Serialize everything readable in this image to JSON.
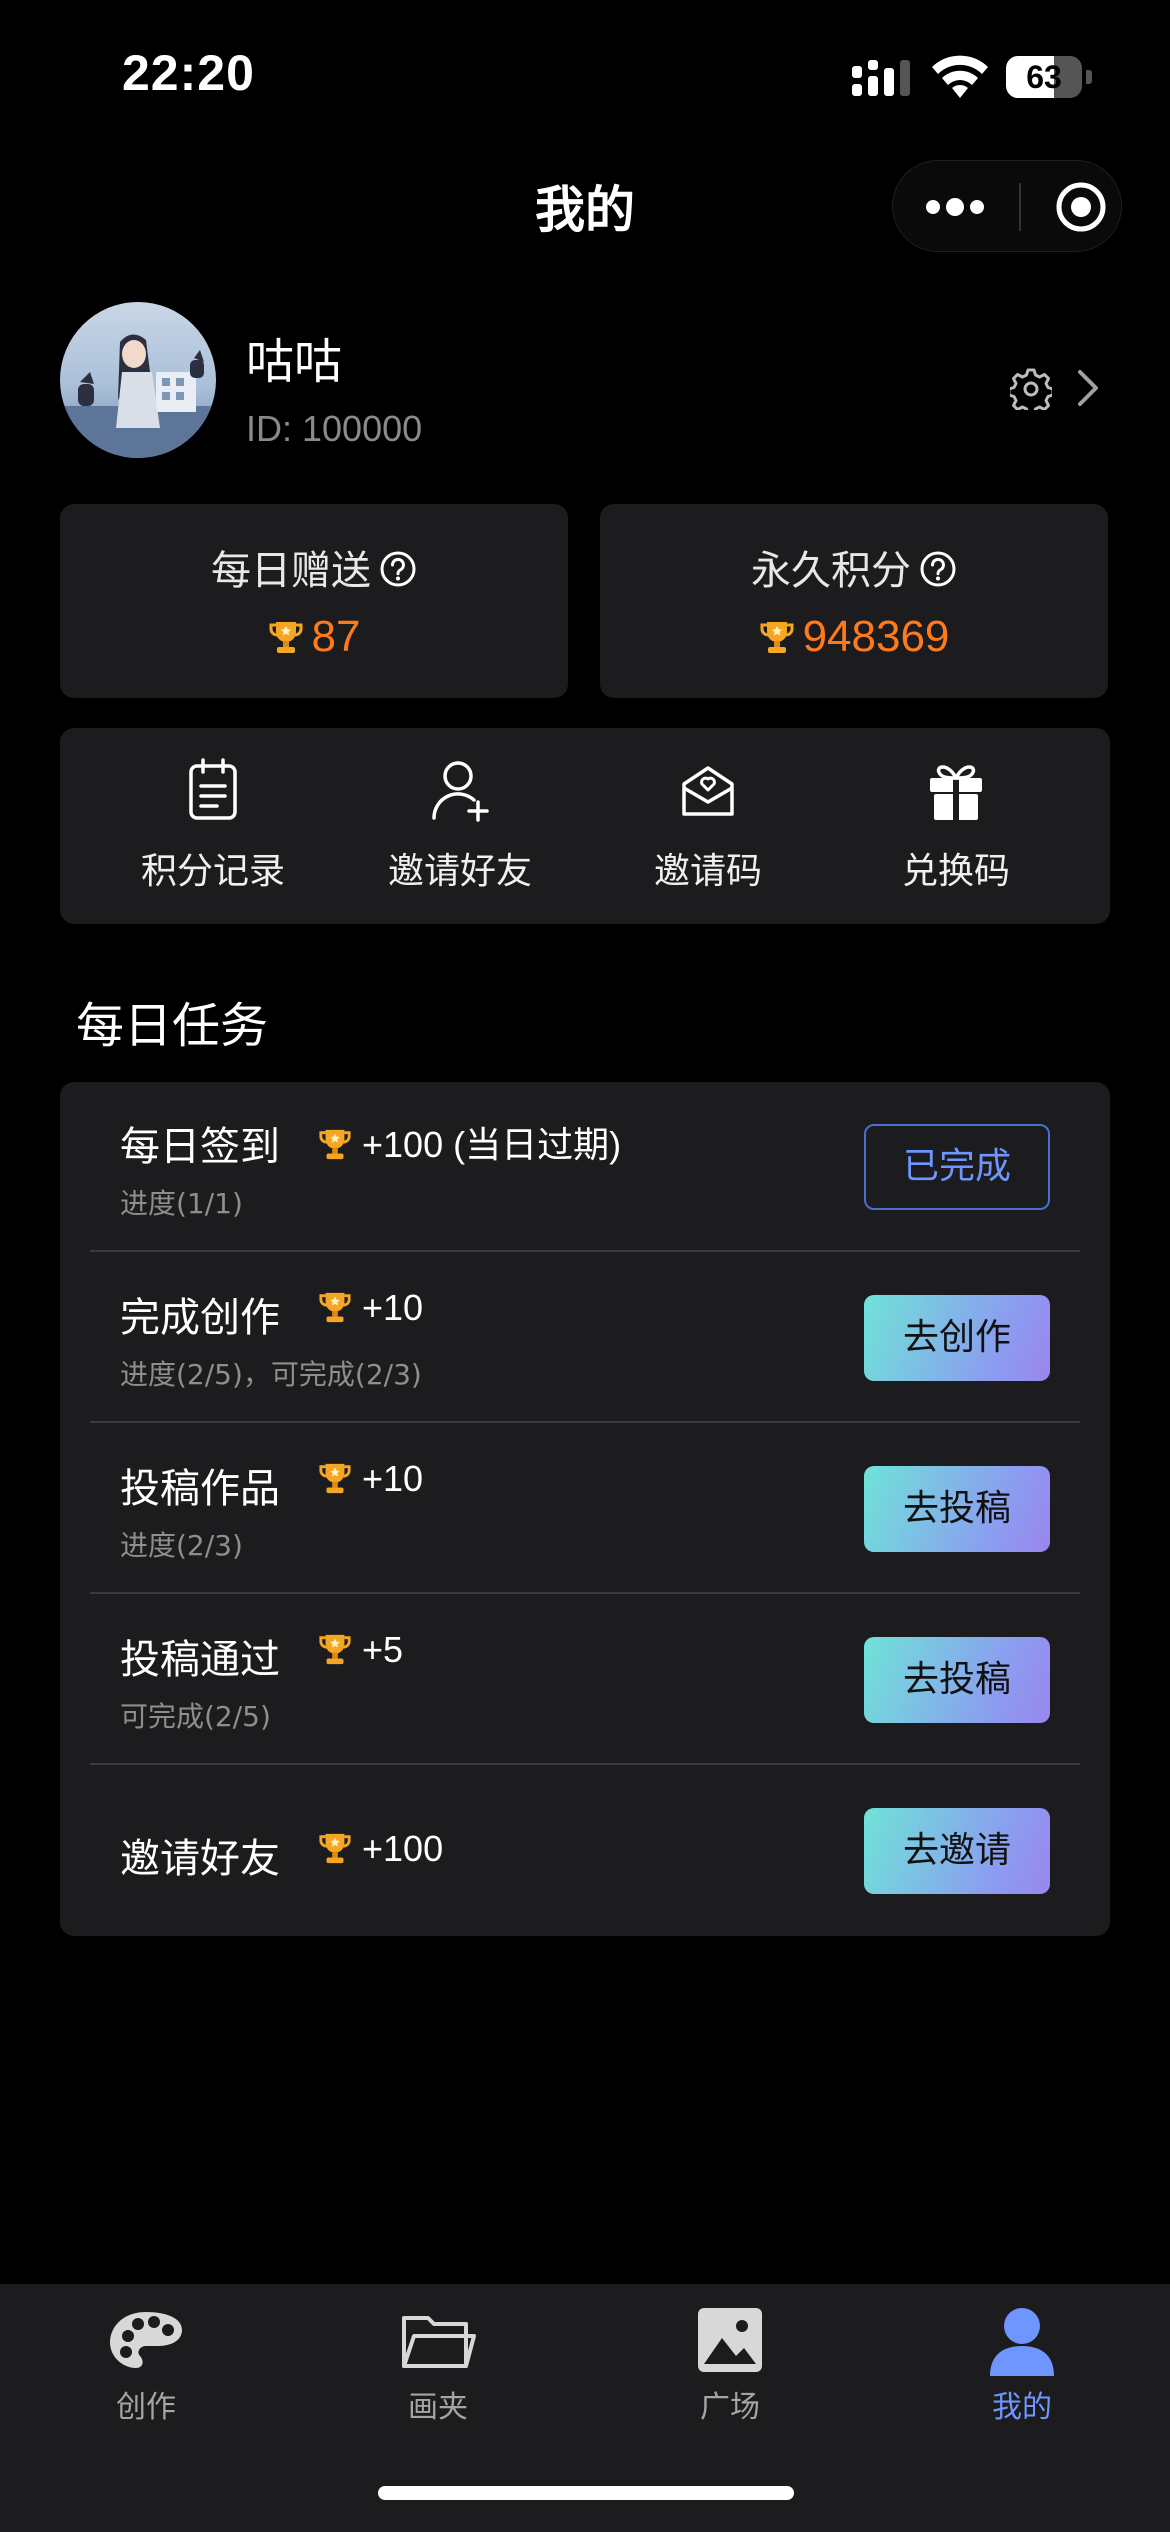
{
  "status_bar": {
    "time": "22:20",
    "battery": "63",
    "battery_level": 0.63
  },
  "header": {
    "title": "我的"
  },
  "profile": {
    "name": "咕咕",
    "id_text": "ID: 100000"
  },
  "points": {
    "daily": {
      "label": "每日赠送",
      "value": "87"
    },
    "permanent": {
      "label": "永久积分",
      "value": "948369"
    }
  },
  "actions": [
    {
      "label": "积分记录",
      "icon": "clipboard-icon"
    },
    {
      "label": "邀请好友",
      "icon": "add-user-icon"
    },
    {
      "label": "邀请码",
      "icon": "envelope-heart-icon"
    },
    {
      "label": "兑换码",
      "icon": "gift-icon"
    }
  ],
  "tasks_section": {
    "title": "每日任务"
  },
  "tasks": [
    {
      "name": "每日签到",
      "reward": "+100 (当日过期)",
      "progress": "进度(1/1)",
      "button": "已完成"
    },
    {
      "name": "完成创作",
      "reward": "+10",
      "progress": "进度(2/5)，可完成(2/3)",
      "button": "去创作"
    },
    {
      "name": "投稿作品",
      "reward": "+10",
      "progress": "进度(2/3)",
      "button": "去投稿"
    },
    {
      "name": "投稿通过",
      "reward": "+5",
      "progress": "可完成(2/5)",
      "button": "去投稿"
    },
    {
      "name": "邀请好友",
      "reward": "+100",
      "progress": "",
      "button": "去邀请"
    }
  ],
  "tabbar": {
    "tabs": [
      {
        "label": "创作",
        "icon": "palette-icon"
      },
      {
        "label": "画夹",
        "icon": "folder-icon"
      },
      {
        "label": "广场",
        "icon": "image-icon"
      },
      {
        "label": "我的",
        "icon": "user-icon"
      }
    ],
    "active": "我的"
  },
  "colors": {
    "background": "#000000",
    "card": "#1c1c1e",
    "points": "#ff7a1a",
    "accent": "#6f95ff",
    "trophy": "#f5a623"
  }
}
